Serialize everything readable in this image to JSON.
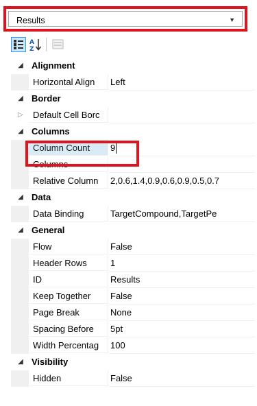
{
  "object_selector": {
    "value": "Results",
    "arrow_icon": "dropdown-arrow-icon"
  },
  "toolbar": {
    "categorized_icon": "categorized-view-icon",
    "alphabetical_icon": "sort-alphabetical-icon",
    "pages_icon": "property-pages-icon"
  },
  "categories": [
    {
      "name": "Alignment",
      "expanded": true,
      "properties": [
        {
          "name": "Horizontal Align",
          "value": "Left"
        }
      ]
    },
    {
      "name": "Border",
      "expanded": true,
      "properties": [
        {
          "name": "Default Cell Borc",
          "value": "",
          "expandable": true
        }
      ]
    },
    {
      "name": "Columns",
      "expanded": true,
      "properties": [
        {
          "name": "Column Count",
          "value": "9",
          "selected": true
        },
        {
          "name": "Columns",
          "value": ""
        },
        {
          "name": "Relative Column",
          "value": "2,0.6,1.4,0.9,0.6,0.9,0.5,0.7"
        }
      ]
    },
    {
      "name": "Data",
      "expanded": true,
      "properties": [
        {
          "name": "Data Binding",
          "value": "TargetCompound,TargetPe"
        }
      ]
    },
    {
      "name": "General",
      "expanded": true,
      "properties": [
        {
          "name": "Flow",
          "value": "False"
        },
        {
          "name": "Header Rows",
          "value": "1"
        },
        {
          "name": "ID",
          "value": "Results"
        },
        {
          "name": "Keep Together",
          "value": "False"
        },
        {
          "name": "Page Break",
          "value": "None"
        },
        {
          "name": "Spacing Before",
          "value": "5pt"
        },
        {
          "name": "Width Percentag",
          "value": "100"
        }
      ]
    },
    {
      "name": "Visibility",
      "expanded": true,
      "properties": [
        {
          "name": "Hidden",
          "value": "False"
        }
      ]
    }
  ],
  "colors": {
    "highlight": "#e0141e",
    "selected_name_bg": "#d9ebf7",
    "margin": "#f0f0f0"
  }
}
